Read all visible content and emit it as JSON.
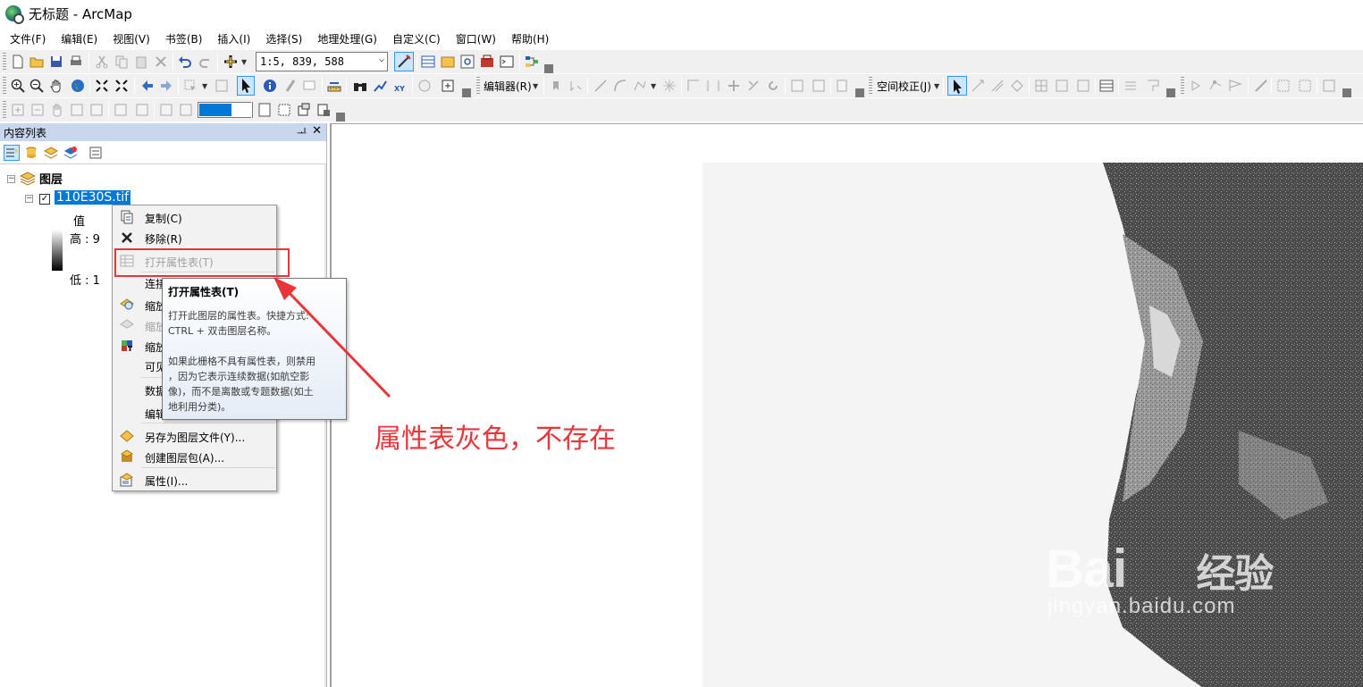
{
  "window": {
    "title": "无标题 - ArcMap"
  },
  "menubar": {
    "items": [
      "文件(F)",
      "编辑(E)",
      "视图(V)",
      "书签(B)",
      "插入(I)",
      "选择(S)",
      "地理处理(G)",
      "自定义(C)",
      "窗口(W)",
      "帮助(H)"
    ]
  },
  "toolbar": {
    "scale_value": "1:5, 839, 588",
    "editor_label": "编辑器(R)",
    "georef_label": "空间校正(J)"
  },
  "toc": {
    "title": "内容列表",
    "pin": "ᅟ",
    "close": "✕",
    "root_label": "图层",
    "layer_name": "110E30S.tif",
    "legend_title": "值",
    "legend_high": "高 : 9",
    "legend_low": "低 : 1"
  },
  "context_menu": {
    "items": [
      {
        "label": "复制(C)",
        "icon": "copy-icon",
        "enabled": true
      },
      {
        "label": "移除(R)",
        "icon": "remove-icon",
        "enabled": true
      },
      {
        "label": "打开属性表(T)",
        "icon": "table-icon",
        "enabled": false
      },
      {
        "label": "连接",
        "icon": "",
        "enabled": true
      },
      {
        "label": "缩放",
        "icon": "zoom-layer-icon",
        "enabled": true
      },
      {
        "label": "缩放",
        "icon": "zoom-resolution-icon",
        "enabled": false
      },
      {
        "label": "缩放",
        "icon": "zoom-raster-icon",
        "enabled": true
      },
      {
        "label": "可见",
        "icon": "",
        "enabled": true
      },
      {
        "label": "数据",
        "icon": "",
        "enabled": true
      },
      {
        "label": "编辑",
        "icon": "",
        "enabled": true
      },
      {
        "label": "另存为图层文件(Y)...",
        "icon": "layer-file-icon",
        "enabled": true
      },
      {
        "label": "创建图层包(A)...",
        "icon": "layer-package-icon",
        "enabled": true
      },
      {
        "label": "属性(I)...",
        "icon": "properties-icon",
        "enabled": true
      }
    ]
  },
  "tooltip": {
    "title": "打开属性表(T)",
    "body": "打开此图层的属性表。快捷方式:\nCTRL + 双击图层名称。\n\n如果此栅格不具有属性表，则禁用\n，因为它表示连续数据(如航空影\n像)，而不是离散或专题数据(如土\n地利用分类)。"
  },
  "annotation": {
    "text": "属性表灰色，不存在",
    "color": "#e8353a"
  },
  "watermark": {
    "brand": "Bai",
    "brand_cn": "经验",
    "url": "jingyan.baidu.com"
  },
  "colors": {
    "selection": "#0078d7",
    "toc_header": "#c9d7ec",
    "toolbar_bg": "#f0f0f0"
  }
}
